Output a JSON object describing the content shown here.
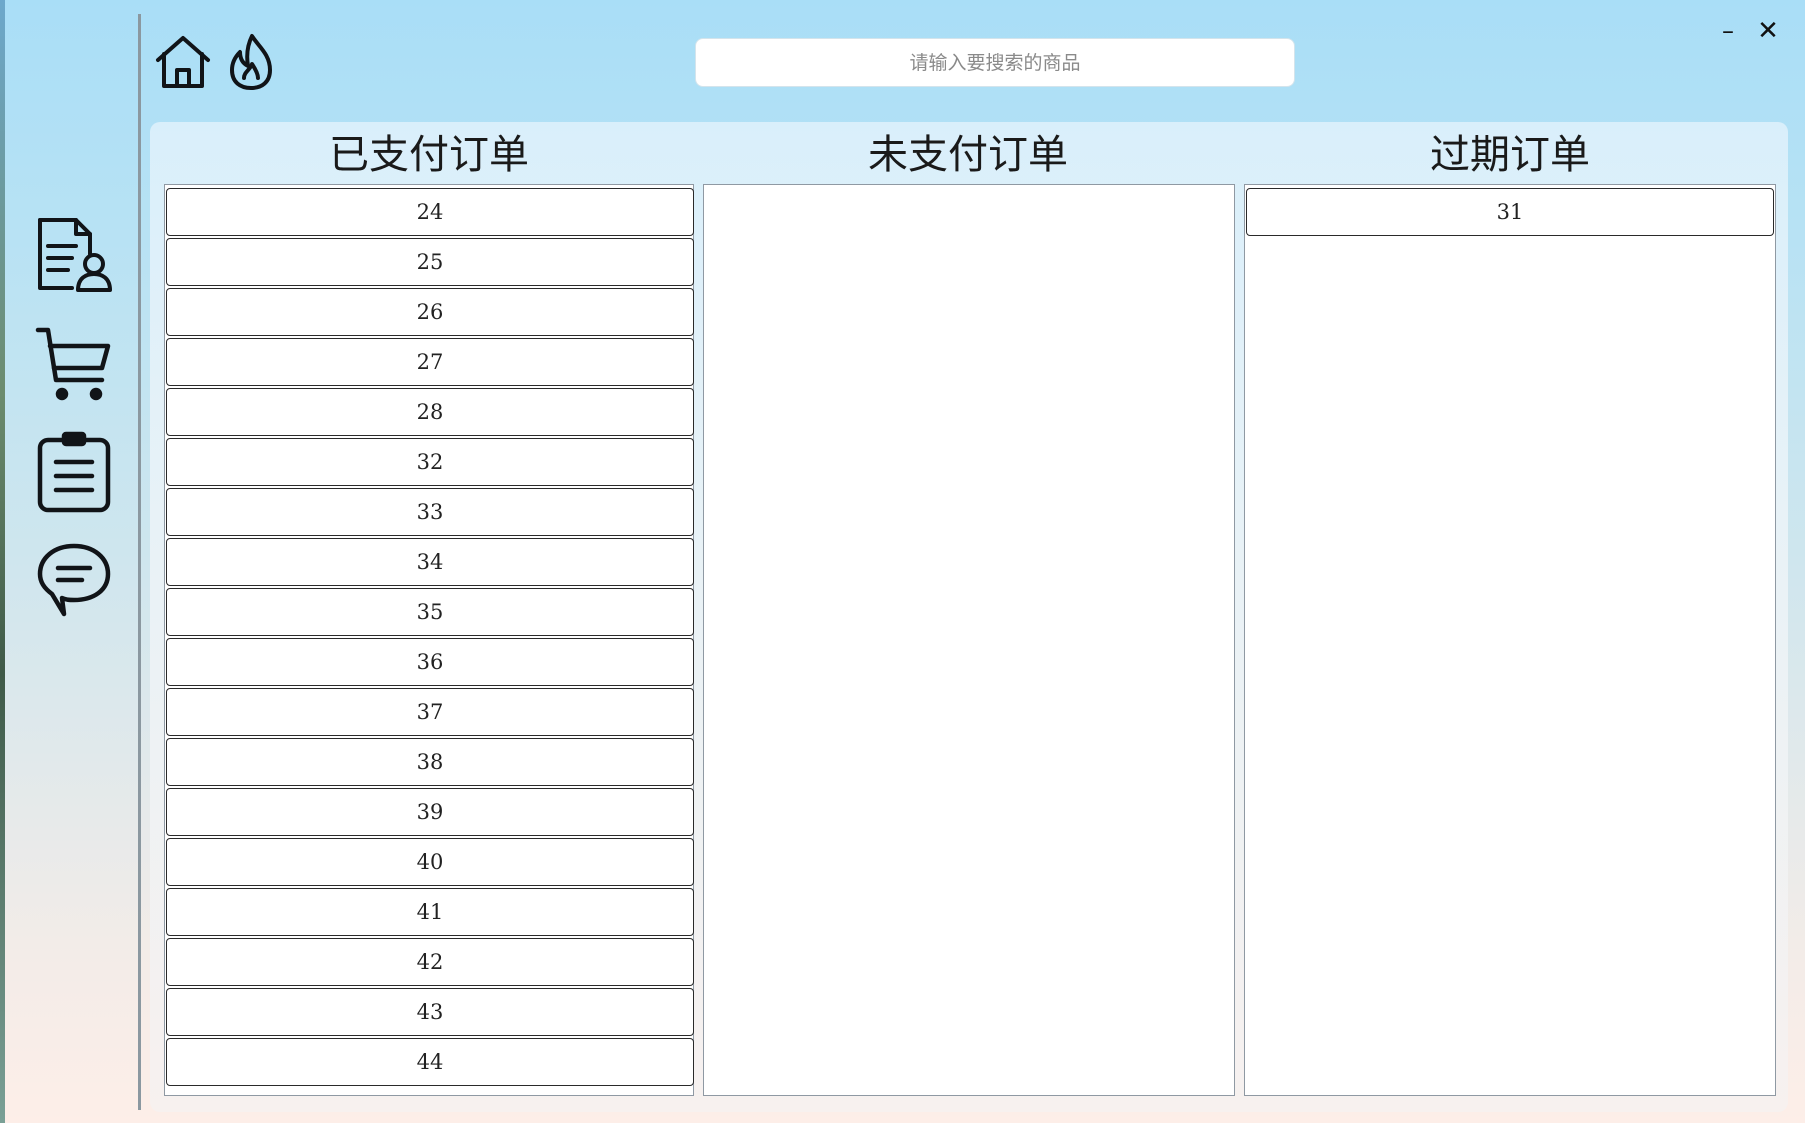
{
  "search": {
    "placeholder": "请输入要搜索的商品"
  },
  "window": {
    "minimize_label": "–",
    "close_label": "✕"
  },
  "icons": {
    "top": [
      "home-icon",
      "fire-icon"
    ],
    "sidebar": [
      "profile-document-icon",
      "shopping-cart-icon",
      "clipboard-list-icon",
      "chat-bubble-icon"
    ]
  },
  "columns": {
    "paid": {
      "title": "已支付订单",
      "orders": [
        "24",
        "25",
        "26",
        "27",
        "28",
        "32",
        "33",
        "34",
        "35",
        "36",
        "37",
        "38",
        "39",
        "40",
        "41",
        "42",
        "43",
        "44"
      ]
    },
    "unpaid": {
      "title": "未支付订单",
      "orders": []
    },
    "expired": {
      "title": "过期订单",
      "orders": [
        "31"
      ]
    }
  },
  "colors": {
    "accent_top": "#a9def7",
    "panel_bg": "#e8f2f7",
    "icon_stroke": "#111418"
  }
}
